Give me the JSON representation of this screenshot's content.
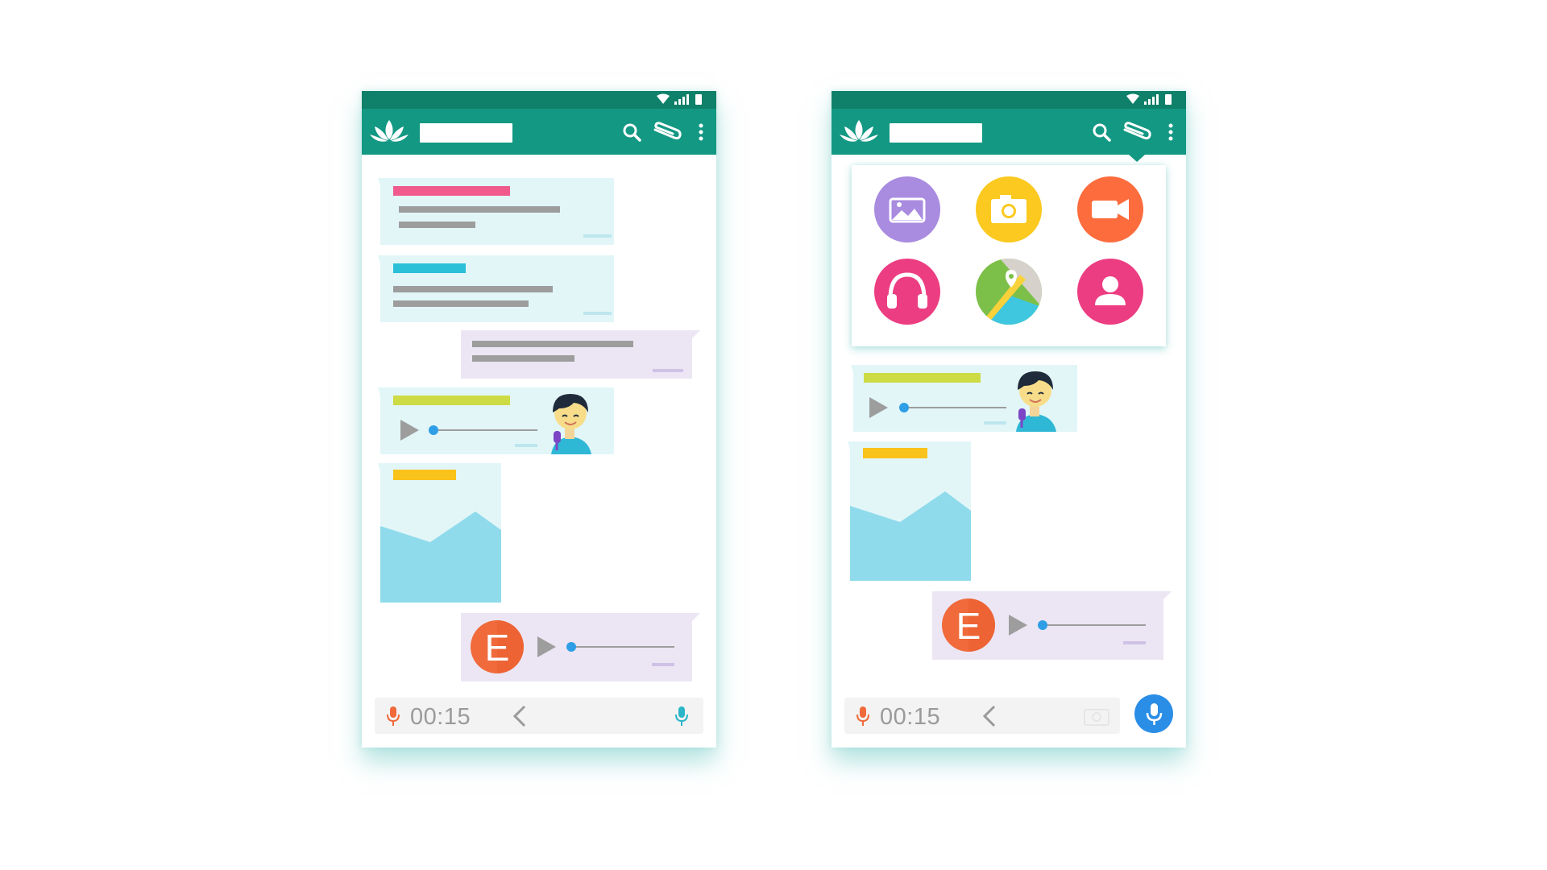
{
  "phones": [
    {
      "id": "left",
      "recording_timer": "00:15"
    },
    {
      "id": "right",
      "recording_timer": "00:15"
    }
  ],
  "colors": {
    "status_bar": "#0f8069",
    "app_bar": "#139883",
    "incoming_bubble": "#e2f6f8",
    "outgoing_bubble": "#ece6f4",
    "accent_pink": "#f05a8c",
    "accent_cyan": "#2bc0d8",
    "accent_lime": "#cddb45",
    "accent_yellow": "#f9c31b",
    "avatar_orange": "#f06a3b",
    "send_blue": "#2a8de6"
  },
  "avatar": {
    "initial": "E"
  },
  "attachment_menu": {
    "items": [
      {
        "name": "gallery-icon",
        "color": "#a98be0"
      },
      {
        "name": "camera-icon",
        "color": "#fbc91f"
      },
      {
        "name": "video-icon",
        "color": "#fc6c3d"
      },
      {
        "name": "audio-icon",
        "color": "#ec3d82"
      },
      {
        "name": "location-icon",
        "color": "#7cc04a"
      },
      {
        "name": "contact-icon",
        "color": "#ec3d82"
      }
    ]
  }
}
